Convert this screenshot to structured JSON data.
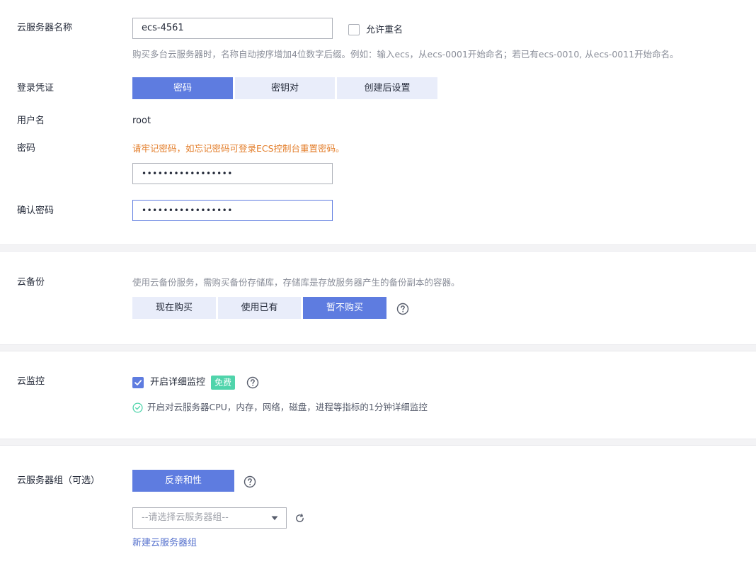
{
  "server_name": {
    "label": "云服务器名称",
    "value": "ecs-4561",
    "allow_duplicate_label": "允许重名",
    "hint": "购买多台云服务器时，名称自动按序增加4位数字后缀。例如：输入ecs，从ecs-0001开始命名；若已有ecs-0010, 从ecs-0011开始命名。"
  },
  "login": {
    "label": "登录凭证",
    "options": [
      "密码",
      "密钥对",
      "创建后设置"
    ],
    "selected": "密码"
  },
  "username": {
    "label": "用户名",
    "value": "root"
  },
  "password": {
    "label": "密码",
    "warning": "请牢记密码，如忘记密码可登录ECS控制台重置密码。",
    "value": "•••••••••••••••••"
  },
  "confirm_password": {
    "label": "确认密码",
    "value": "•••••••••••••••••"
  },
  "backup": {
    "label": "云备份",
    "hint": "使用云备份服务，需购买备份存储库，存储库是存放服务器产生的备份副本的容器。",
    "options": [
      "现在购买",
      "使用已有",
      "暂不购买"
    ],
    "selected": "暂不购买"
  },
  "monitoring": {
    "label": "云监控",
    "checkbox_label": "开启详细监控",
    "badge": "免费",
    "checked": true,
    "status_text": "开启对云服务器CPU，内存，网络，磁盘，进程等指标的1分钟详细监控"
  },
  "server_group": {
    "label": "云服务器组（可选）",
    "policy_button": "反亲和性",
    "select_placeholder": "--请选择云服务器组--",
    "create_link": "新建云服务器组"
  },
  "colors": {
    "primary": "#5e7ce0",
    "segment_bg": "#e9edfa",
    "warning": "#e37d29",
    "success": "#50d4ab",
    "hint": "#8a8e99"
  }
}
